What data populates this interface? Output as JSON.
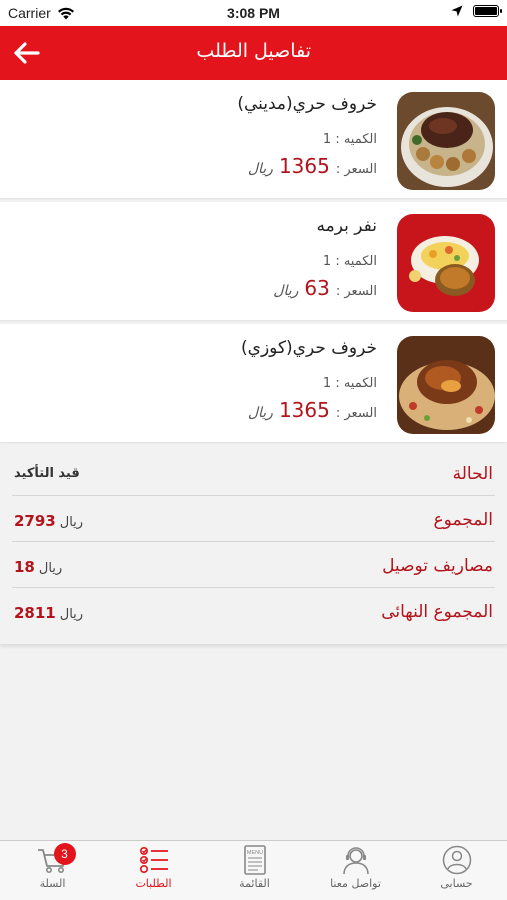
{
  "status_bar": {
    "carrier": "Carrier",
    "time": "3:08 PM"
  },
  "header": {
    "title": "تفاصيل الطلب"
  },
  "items": [
    {
      "name": "خروف حري(مديني)",
      "qty_label": "الكميه : 1",
      "price_label": "السعر :",
      "price": "1365",
      "currency": "ريال"
    },
    {
      "name": "نفر برمه",
      "qty_label": "الكميه : 1",
      "price_label": "السعر :",
      "price": "63",
      "currency": "ريال"
    },
    {
      "name": "خروف حري(كوزي)",
      "qty_label": "الكميه : 1",
      "price_label": "السعر :",
      "price": "1365",
      "currency": "ريال"
    }
  ],
  "summary": {
    "status_label": "الحالة",
    "status_value": "قيد التأكيد",
    "total_label": "المجموع",
    "total_value": "2793",
    "delivery_label": "مصاريف توصيل",
    "delivery_value": "18",
    "final_label": "المجموع النهائى",
    "final_value": "2811",
    "currency": "ريال"
  },
  "tabbar": {
    "cart_label": "السلة",
    "cart_badge": "3",
    "orders_label": "الطلبات",
    "menu_label": "القائمة",
    "menu_icon_text": "MENU",
    "contact_label": "تواصل معنا",
    "account_label": "حسابى"
  },
  "colors": {
    "accent": "#e3141b",
    "price": "#b3141b"
  }
}
